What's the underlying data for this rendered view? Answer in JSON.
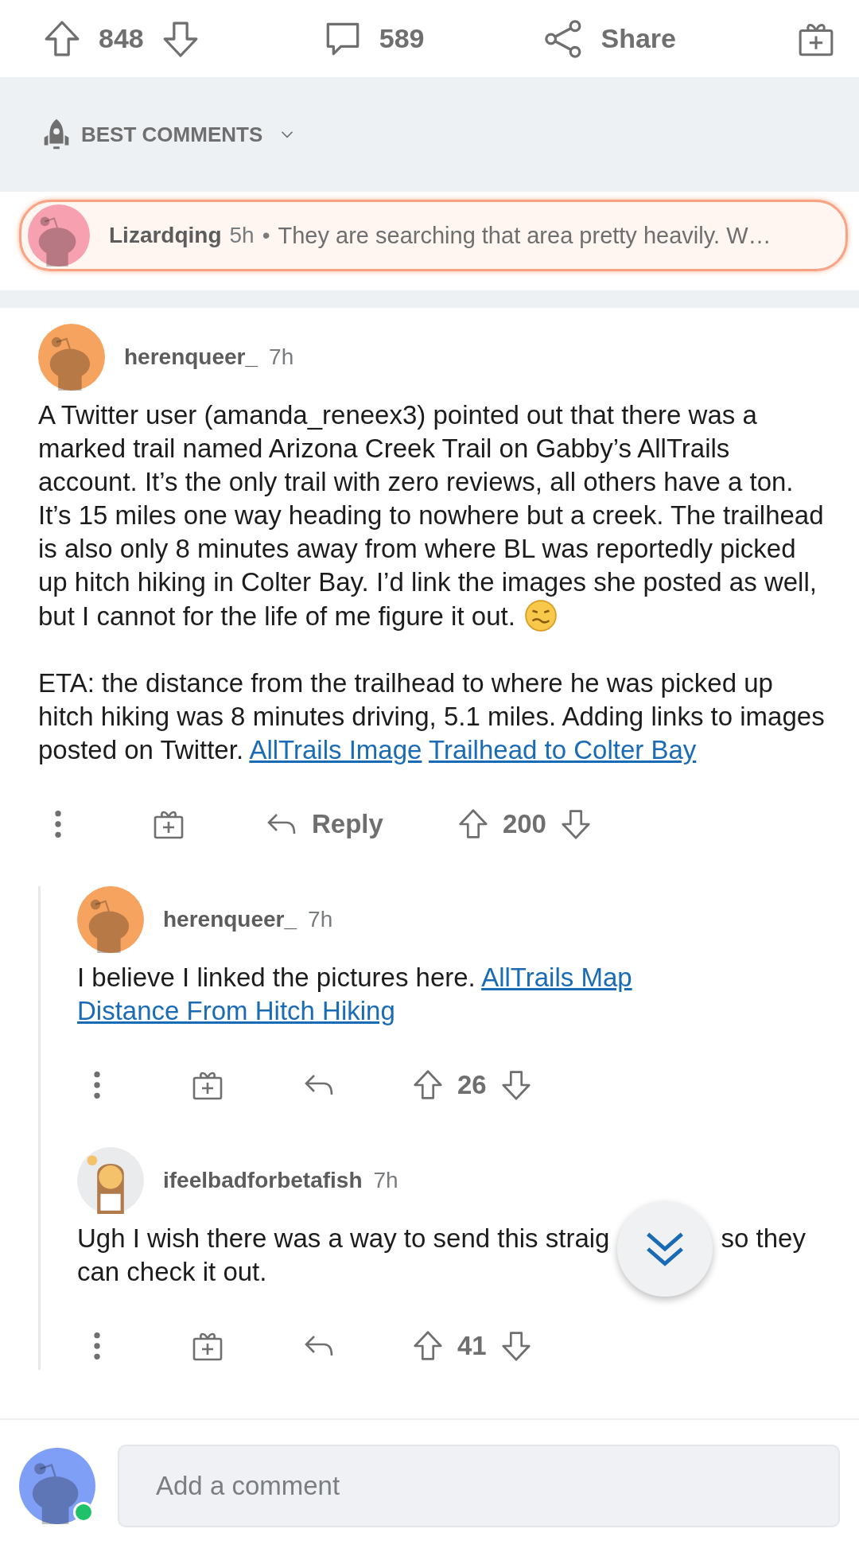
{
  "post_bar": {
    "upvotes": "848",
    "comments": "589",
    "share": "Share"
  },
  "sort": {
    "label": "BEST COMMENTS"
  },
  "pinned": {
    "author": "Lizardqing",
    "time": "5h",
    "separator": "•",
    "snippet": "They are searching that area pretty heavily. W…"
  },
  "comments": [
    {
      "author": "herenqueer_",
      "time": "7h",
      "paragraphs": [
        [
          {
            "kind": "text",
            "text": "A Twitter user (amanda_reneex3) pointed out that there was a marked trail named Arizona Creek Trail on Gabby’s AllTrails account. It’s the only trail with zero reviews, all others have a ton. It’s 15 miles one way heading to nowhere but a creek. The trailhead is also only 8 minutes away from where BL was reportedly picked up hitch hiking in Colter Bay. I’d link the images she posted as well, but I cannot for the life of me figure it out. "
          },
          {
            "kind": "emoji"
          }
        ],
        [
          {
            "kind": "text",
            "text": "ETA: the distance from the trailhead to where he was picked up hitch hiking was 8 minutes driving, 5.1 miles. Adding links to images posted on Twitter. "
          },
          {
            "kind": "link",
            "text": "AllTrails Image"
          },
          {
            "kind": "link",
            "text": "Trailhead to Colter Bay"
          }
        ]
      ],
      "reply": "Reply",
      "score": "200",
      "children": [
        {
          "author": "herenqueer_",
          "time": "7h",
          "paragraphs": [
            [
              {
                "kind": "text",
                "text": "I believe I linked the pictures here. "
              },
              {
                "kind": "link",
                "text": "AllTrails Map"
              },
              {
                "kind": "link",
                "text": "Distance From Hitch Hiking"
              }
            ]
          ],
          "score": "26"
        },
        {
          "author": "ifeelbadforbetafish",
          "time": "7h",
          "paragraphs": [
            [
              {
                "kind": "text",
                "text": "Ugh I wish there was a way to send this straig"
              },
              {
                "kind": "covered"
              },
              {
                "kind": "text",
                "text": "so they can check it out."
              }
            ]
          ],
          "score": "41"
        }
      ]
    }
  ],
  "composer": {
    "placeholder": "Add a comment",
    "online": true
  }
}
